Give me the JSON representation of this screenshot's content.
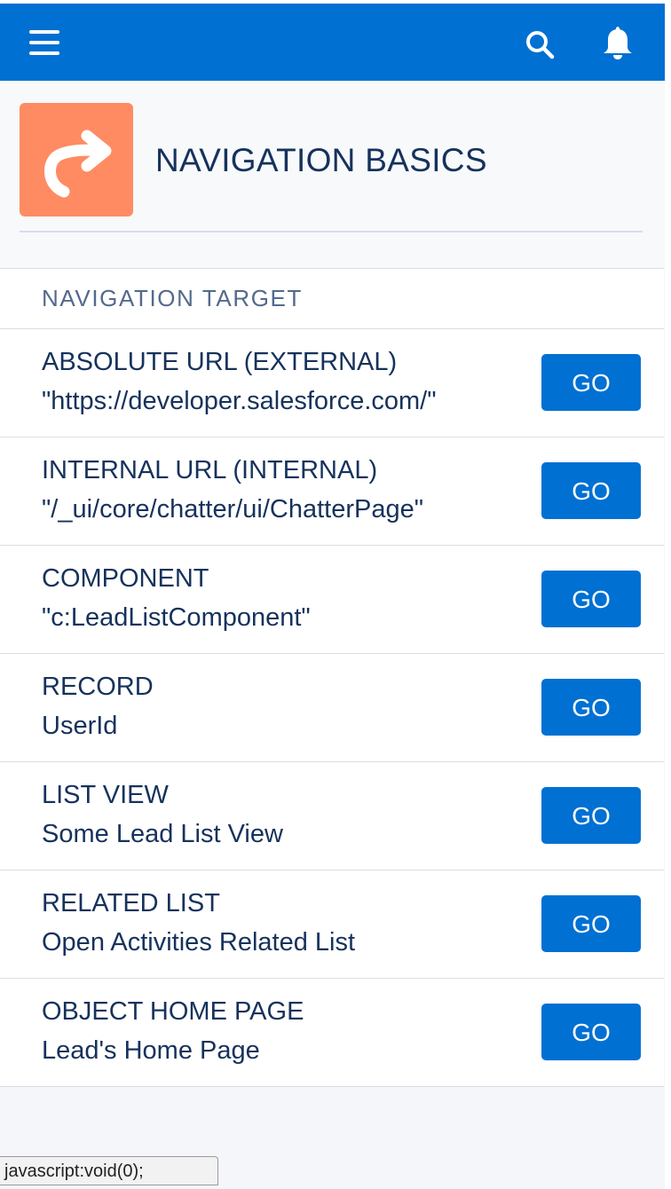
{
  "colors": {
    "brand": "#0070d2",
    "app_icon_bg": "#ff8b63",
    "text_primary": "#16325c",
    "text_secondary": "#54698d",
    "page_bg": "#f4f6f9"
  },
  "header": {
    "menu_icon": "hamburger-menu-icon",
    "search_icon": "search-icon",
    "notifications_icon": "bell-icon"
  },
  "page": {
    "icon": "redo-arrow-icon",
    "title": "NAVIGATION BASICS"
  },
  "table": {
    "header": "NAVIGATION TARGET",
    "rows": [
      {
        "title": "ABSOLUTE URL (EXTERNAL)",
        "subtitle": "\"https://developer.salesforce.com/\"",
        "button": "GO"
      },
      {
        "title": "INTERNAL URL (INTERNAL)",
        "subtitle": "\"/_ui/core/chatter/ui/ChatterPage\"",
        "button": "GO"
      },
      {
        "title": "COMPONENT",
        "subtitle": "\"c:LeadListComponent\"",
        "button": "GO"
      },
      {
        "title": "RECORD",
        "subtitle": "UserId",
        "button": "GO"
      },
      {
        "title": "LIST VIEW",
        "subtitle": "Some Lead List View",
        "button": "GO"
      },
      {
        "title": "RELATED LIST",
        "subtitle": "Open Activities Related List",
        "button": "GO"
      },
      {
        "title": "OBJECT HOME PAGE",
        "subtitle": "Lead's Home Page",
        "button": "GO"
      }
    ]
  },
  "status_bar": {
    "text": "javascript:void(0);"
  }
}
